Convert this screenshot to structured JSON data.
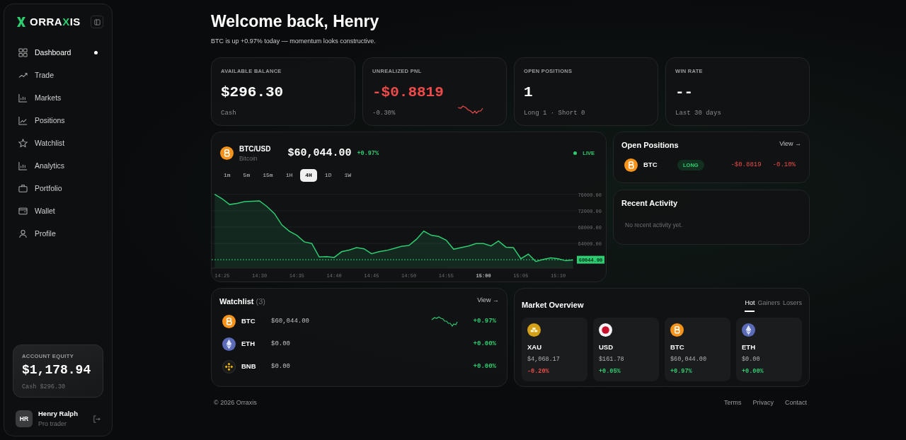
{
  "sidebar": {
    "brand": [
      {
        "text": "ORRA",
        "accent": false
      },
      {
        "text": "X",
        "accent": true
      },
      {
        "text": "IS",
        "accent": false
      }
    ],
    "nav": [
      {
        "label": "Dashboard",
        "selected": true
      },
      {
        "label": "Trade",
        "selected": false
      },
      {
        "label": "Markets",
        "selected": false
      },
      {
        "label": "Positions",
        "selected": false
      },
      {
        "label": "Watchlist",
        "selected": false
      },
      {
        "label": "Analytics",
        "selected": false
      },
      {
        "label": "Portfolio",
        "selected": false
      },
      {
        "label": "Wallet",
        "selected": false
      },
      {
        "label": "Profile",
        "selected": false
      }
    ],
    "equity": {
      "label": "ACCOUNT EQUITY",
      "value": "$1,178.94",
      "note": "Cash $296.30"
    },
    "user": {
      "initials": "HR",
      "name": "Henry Ralph",
      "role": "Pro trader"
    }
  },
  "header": {
    "title": "Welcome back, Henry",
    "subtitle": "BTC is up +0.97% today — momentum looks constructive."
  },
  "stats": [
    {
      "label": "AVAILABLE BALANCE",
      "value": "$296.30",
      "note": "Cash",
      "sparkline": false,
      "negative": false
    },
    {
      "label": "UNREALIZED PNL",
      "value": "-$0.8819",
      "note": "-0.30%",
      "sparkline": true,
      "negative": true
    },
    {
      "label": "OPEN POSITIONS",
      "value": "1",
      "note": "Long 1 · Short 0",
      "sparkline": false,
      "negative": false
    },
    {
      "label": "WIN RATE",
      "value": "--",
      "note": "Last 30 days",
      "sparkline": false,
      "negative": false
    }
  ],
  "price_chart": {
    "symbol": "BTC/USD",
    "name": "Bitcoin",
    "kind": "bitcoin",
    "price": "$60,044.00",
    "change": "+0.97%",
    "live": "LIVE",
    "timeframes": [
      {
        "label": "1m",
        "selected": false
      },
      {
        "label": "5m",
        "selected": false
      },
      {
        "label": "15m",
        "selected": false
      },
      {
        "label": "1H",
        "selected": false
      },
      {
        "label": "4H",
        "selected": true
      },
      {
        "label": "1D",
        "selected": false
      },
      {
        "label": "1W",
        "selected": false
      }
    ],
    "chart_data": {
      "type": "area",
      "grid": true,
      "ref_lines": [
        {
          "axis": "y",
          "value": 60044,
          "label": "60044.00",
          "color": "#2ecc71"
        }
      ],
      "categories": [
        null,
        "14:25",
        null,
        null,
        null,
        null,
        "14:30",
        null,
        null,
        null,
        null,
        "14:35",
        null,
        null,
        null,
        null,
        "14:40",
        null,
        null,
        null,
        null,
        "14:45",
        null,
        null,
        null,
        null,
        "14:50",
        null,
        null,
        null,
        null,
        "14:55",
        null,
        null,
        null,
        null,
        "15:00",
        null,
        null,
        null,
        null,
        "15:05",
        null,
        null,
        null,
        null,
        "15:10",
        null,
        null
      ],
      "series": [
        {
          "color": "#2ecc71",
          "values": [
            76000,
            74900,
            73500,
            73800,
            74200,
            74300,
            74400,
            73000,
            71300,
            68500,
            67000,
            66000,
            64400,
            64000,
            60700,
            60800,
            60600,
            62000,
            62400,
            63000,
            62700,
            61500,
            62000,
            62300,
            62800,
            63300,
            63500,
            65000,
            67000,
            66000,
            65700,
            64800,
            62600,
            63000,
            63400,
            64000,
            64000,
            63400,
            64600,
            63100,
            63000,
            60300,
            61400,
            59600,
            60100,
            60500,
            60300,
            59800,
            60000
          ]
        }
      ],
      "ylim": [
        58000,
        76000
      ],
      "yticks": [
        {
          "value": 64000,
          "label": "64000.00"
        },
        {
          "value": 68000,
          "label": "68000.00"
        },
        {
          "value": 72000,
          "label": "72000.00"
        },
        {
          "value": 76000,
          "label": "76000.00"
        }
      ]
    }
  },
  "open_positions": {
    "title": "Open Positions",
    "link": "View →",
    "rows": [
      {
        "symbol": "BTC",
        "kind": "bitcoin",
        "side": "LONG",
        "pnl": "-$0.8819",
        "pct": "-0.10%",
        "negative": true
      }
    ]
  },
  "recent_activity": {
    "title": "Recent Activity",
    "empty": "No recent activity yet."
  },
  "watchlist": {
    "title": "Watchlist",
    "count": "(3)",
    "link": "View →",
    "rows": [
      {
        "symbol": "BTC",
        "kind": "bitcoin",
        "price": "$60,044.00",
        "change": "+0.97%",
        "negative": false,
        "sparkline": true
      },
      {
        "symbol": "ETH",
        "kind": "ether",
        "price": "$0.00",
        "change": "+0.00%",
        "negative": false,
        "sparkline": false
      },
      {
        "symbol": "BNB",
        "kind": "bnb",
        "price": "$0.00",
        "change": "+0.00%",
        "negative": false,
        "sparkline": false
      }
    ]
  },
  "market_overview": {
    "title": "Market Overview",
    "tabs": [
      {
        "label": "Hot",
        "selected": true
      },
      {
        "label": "Gainers",
        "selected": false
      },
      {
        "label": "Losers",
        "selected": false
      }
    ],
    "tiles": [
      {
        "symbol": "XAU",
        "kind": "gold",
        "price": "$4,068.17",
        "change": "-0.20%",
        "negative": true
      },
      {
        "symbol": "USD",
        "kind": "dollar",
        "price": "$161.78",
        "change": "+0.05%",
        "negative": false
      },
      {
        "symbol": "BTC",
        "kind": "bitcoin",
        "price": "$60,044.00",
        "change": "+0.97%",
        "negative": false
      },
      {
        "symbol": "ETH",
        "kind": "ether",
        "price": "$0.00",
        "change": "+0.00%",
        "negative": false
      }
    ]
  },
  "footer": {
    "copyright": "© 2026 Orraxis",
    "links": [
      "Terms",
      "Privacy",
      "Contact"
    ]
  }
}
